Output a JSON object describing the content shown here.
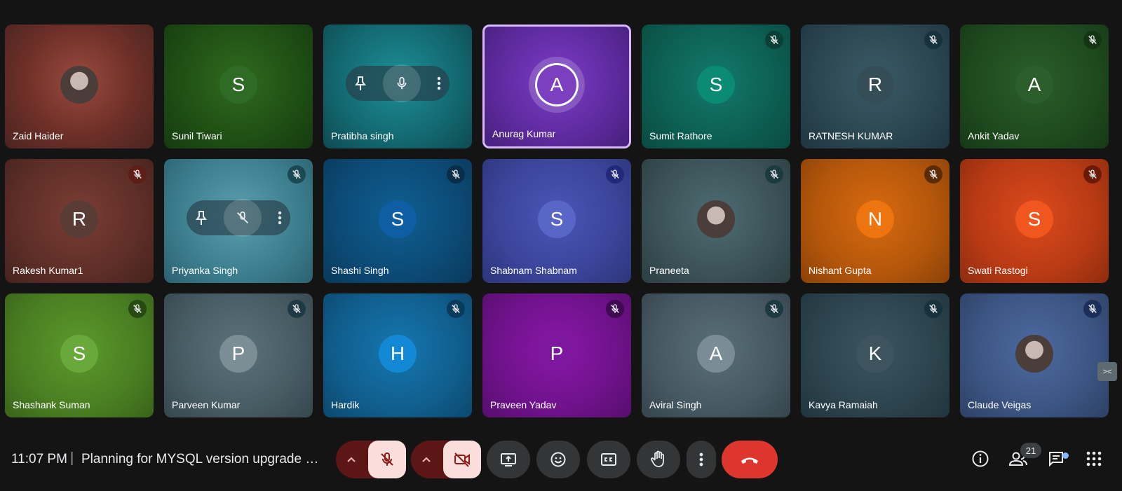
{
  "participants": [
    {
      "name": "Zaid Haider",
      "initial": "",
      "photo": true,
      "muted": false,
      "bg": "radial-gradient(circle at 50% 45%, #9a4a3e 0%, #6d2f28 55%, #4a2420 100%)",
      "avatar": "",
      "mic": ""
    },
    {
      "name": "Sunil Tiwari",
      "initial": "S",
      "photo": false,
      "muted": false,
      "bg": "radial-gradient(circle at 50% 45%, #2f6a1e 0%, #1f4f14 60%, #163a10 100%)",
      "avatar": "#2e6b25",
      "mic": ""
    },
    {
      "name": "Pratibha singh",
      "initial": "",
      "photo": false,
      "muted": false,
      "hover": true,
      "bg": "radial-gradient(circle at 50% 45%, #1d8f98 0%, #136870 60%, #0f4a52 100%)",
      "avatar": "",
      "mic": ""
    },
    {
      "name": "Anurag Kumar",
      "initial": "A",
      "photo": false,
      "muted": false,
      "active": true,
      "bg": "radial-gradient(circle at 50% 45%, #7c3cc7 0%, #5e2a9e 60%, #46207a 100%)",
      "avatar": "#7b3fc0",
      "mic": ""
    },
    {
      "name": "Sumit Rathore",
      "initial": "S",
      "photo": false,
      "muted": true,
      "bg": "radial-gradient(circle at 50% 45%, #117a6a 0%, #0d5e52 60%, #0a4a40 100%)",
      "avatar": "#0b8a74",
      "mic": "#0a3f37"
    },
    {
      "name": "RATNESH KUMAR",
      "initial": "R",
      "photo": false,
      "muted": true,
      "bg": "radial-gradient(circle at 50% 45%, #3b5a66 0%, #2b4651 60%, #1f3540 100%)",
      "avatar": "#344d57",
      "mic": "#17323c"
    },
    {
      "name": "Ankit Yadav",
      "initial": "A",
      "photo": false,
      "muted": true,
      "bg": "radial-gradient(circle at 50% 45%, #2a5e2a 0%, #1f4a1f 60%, #163816 100%)",
      "avatar": "#2c5e2c",
      "mic": "#133513"
    },
    {
      "name": "Rakesh Kumar1",
      "initial": "R",
      "photo": false,
      "muted": true,
      "bg": "radial-gradient(circle at 50% 45%, #7a3e34 0%, #5e2e27 60%, #46231e 100%)",
      "avatar": "#5a3c36",
      "mic": "#5e1d17"
    },
    {
      "name": "Priyanka Singh",
      "initial": "",
      "photo": false,
      "muted": true,
      "hover": true,
      "hoverPhoto": true,
      "bg": "radial-gradient(circle at 50% 45%, #5c9fae 0%, #3c7e8e 60%, #2c6170 100%)",
      "avatar": "",
      "mic": "#1b4a55"
    },
    {
      "name": "Shashi Singh",
      "initial": "S",
      "photo": false,
      "muted": true,
      "bg": "radial-gradient(circle at 50% 45%, #0f5f92 0%, #0c4a75 60%, #09395b 100%)",
      "avatar": "#0d5ea3",
      "mic": "#0a2d4a"
    },
    {
      "name": "Shabnam Shabnam",
      "initial": "S",
      "photo": false,
      "muted": true,
      "bg": "radial-gradient(circle at 50% 45%, #4b56b8 0%, #3a4499 60%, #2d3579 100%)",
      "avatar": "#5965c7",
      "mic": "#22297a"
    },
    {
      "name": "Praneeta",
      "initial": "",
      "photo": true,
      "muted": true,
      "bg": "radial-gradient(circle at 50% 45%, #4e6c72 0%, #3b5257 60%, #2c3e42 100%)",
      "avatar": "",
      "mic": "#1c3a40"
    },
    {
      "name": "Nishant Gupta",
      "initial": "N",
      "photo": false,
      "muted": true,
      "bg": "radial-gradient(circle at 50% 45%, #d86a0f 0%, #b3560b 60%, #8a4208 100%)",
      "avatar": "#ee7410",
      "mic": "#5c2c07"
    },
    {
      "name": "Swati Rastogi",
      "initial": "S",
      "photo": false,
      "muted": true,
      "bg": "radial-gradient(circle at 50% 45%, #dc4a1c 0%, #b83a14 60%, #8e2c0f 100%)",
      "avatar": "#f2561f",
      "mic": "#6a1b08"
    },
    {
      "name": "Shashank Suman",
      "initial": "S",
      "photo": false,
      "muted": true,
      "bg": "radial-gradient(circle at 50% 45%, #5c9a2c 0%, #4a7e22 60%, #39631a 100%)",
      "avatar": "#69a83a",
      "mic": "#274a12"
    },
    {
      "name": "Parveen Kumar",
      "initial": "P",
      "photo": false,
      "muted": true,
      "bg": "radial-gradient(circle at 50% 45%, #5c727b 0%, #475b63 60%, #36464d 100%)",
      "avatar": "#7b8d95",
      "mic": "#1f3a44"
    },
    {
      "name": "Hardik",
      "initial": "H",
      "photo": false,
      "muted": true,
      "bg": "radial-gradient(circle at 50% 45%, #1577b0 0%, #105e8d 60%, #0c486d 100%)",
      "avatar": "#1389d6",
      "mic": "#0a3a5c"
    },
    {
      "name": "Praveen Yadav",
      "initial": "P",
      "photo": false,
      "muted": true,
      "bg": "radial-gradient(circle at 50% 45%, #8a17a8 0%, #6e128a 60%, #560e6c 100%)",
      "avatar": "#7e17a0",
      "mic": "#3e0a52"
    },
    {
      "name": "Aviral Singh",
      "initial": "A",
      "photo": false,
      "muted": true,
      "bg": "radial-gradient(circle at 50% 45%, #5a6f7a 0%, #465862 60%, #35444c 100%)",
      "avatar": "#7a8c95",
      "mic": "#1d3942"
    },
    {
      "name": "Kavya Ramaiah",
      "initial": "K",
      "photo": false,
      "muted": true,
      "bg": "radial-gradient(circle at 50% 45%, #3a5560 0%, #2c434d 60%, #21343c 100%)",
      "avatar": "#3d545e",
      "mic": "#17323c"
    },
    {
      "name": "Claude Veigas",
      "initial": "",
      "photo": true,
      "muted": true,
      "bg": "radial-gradient(circle at 50% 45%, #4d6aa0 0%, #3c5482 60%, #2e4165 100%)",
      "avatar": "",
      "mic": "#1c2f5a"
    }
  ],
  "bottom_bar": {
    "time": "11:07 PM",
    "separator": "|",
    "meeting_title": "Planning for MYSQL version upgrade S...",
    "participant_count": "21"
  }
}
